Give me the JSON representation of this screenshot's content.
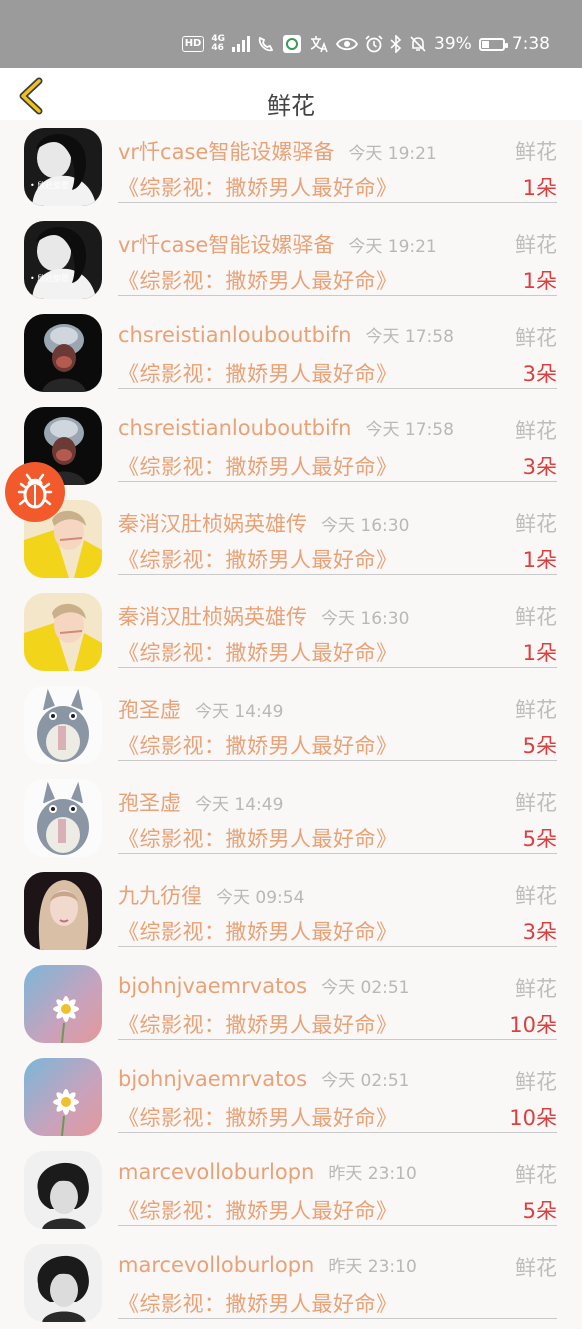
{
  "status_bar": {
    "hd": "HD",
    "network": "4G",
    "network_sub": "46",
    "battery": "39%",
    "battery_level": 0.39,
    "time": "7:38",
    "icons": [
      "signal-icon",
      "wifi-call-icon",
      "app-icon",
      "translate-icon",
      "eye-icon",
      "alarm-icon",
      "bluetooth-icon",
      "mute-icon",
      "battery-icon"
    ]
  },
  "header": {
    "title": "鲜花",
    "back_icon": "back-chevron-icon"
  },
  "gift_records": [
    {
      "name": "vr忏case智能设嫘驿备",
      "time": "今天 19:21",
      "type": "鲜花",
      "gift": "《综影视：撒娇男人最好命》",
      "count": "1朵",
      "avatar": "woman-bw"
    },
    {
      "name": "vr忏case智能设嫘驿备",
      "time": "今天 19:21",
      "type": "鲜花",
      "gift": "《综影视：撒娇男人最好命》",
      "count": "1朵",
      "avatar": "woman-bw"
    },
    {
      "name": "chsreistianlouboutbifn",
      "time": "今天 17:58",
      "type": "鲜花",
      "gift": "《综影视：撒娇男人最好命》",
      "count": "3朵",
      "avatar": "dark-figure"
    },
    {
      "name": "chsreistianlouboutbifn",
      "time": "今天 17:58",
      "type": "鲜花",
      "gift": "《综影视：撒娇男人最好命》",
      "count": "3朵",
      "avatar": "dark-figure"
    },
    {
      "name": "秦消汉肚桢娲英雄传",
      "time": "今天 16:30",
      "type": "鲜花",
      "gift": "《综影视：撒娇男人最好命》",
      "count": "1朵",
      "avatar": "yellow-girl"
    },
    {
      "name": "秦消汉肚桢娲英雄传",
      "time": "今天 16:30",
      "type": "鲜花",
      "gift": "《综影视：撒娇男人最好命》",
      "count": "1朵",
      "avatar": "yellow-girl"
    },
    {
      "name": "孢圣虚",
      "time": "今天 14:49",
      "type": "鲜花",
      "gift": "《综影视：撒娇男人最好命》",
      "count": "5朵",
      "avatar": "totoro"
    },
    {
      "name": "孢圣虚",
      "time": "今天 14:49",
      "type": "鲜花",
      "gift": "《综影视：撒娇男人最好命》",
      "count": "5朵",
      "avatar": "totoro"
    },
    {
      "name": "九九彷徨",
      "time": "今天 09:54",
      "type": "鲜花",
      "gift": "《综影视：撒娇男人最好命》",
      "count": "3朵",
      "avatar": "blonde-girl"
    },
    {
      "name": "bjohnjvaemrvatos",
      "time": "今天 02:51",
      "type": "鲜花",
      "gift": "《综影视：撒娇男人最好命》",
      "count": "10朵",
      "avatar": "daisy"
    },
    {
      "name": "bjohnjvaemrvatos",
      "time": "今天 02:51",
      "type": "鲜花",
      "gift": "《综影视：撒娇男人最好命》",
      "count": "10朵",
      "avatar": "daisy"
    },
    {
      "name": "marcevolloburlopn",
      "time": "昨天 23:10",
      "type": "鲜花",
      "gift": "《综影视：撒娇男人最好命》",
      "count": "5朵",
      "avatar": "curly-man"
    },
    {
      "name": "marcevolloburlopn",
      "time": "昨天 23:10",
      "type": "鲜花",
      "gift": "《综影视：撒娇男人最好命》",
      "count": "",
      "avatar": "curly-man"
    }
  ],
  "floating_button": {
    "icon": "bug-icon",
    "color": "#f25a2c"
  },
  "colors": {
    "name": "#e8a276",
    "count": "#d9403f",
    "muted": "#b8b8b8",
    "status_bar": "#9b9b9b"
  }
}
